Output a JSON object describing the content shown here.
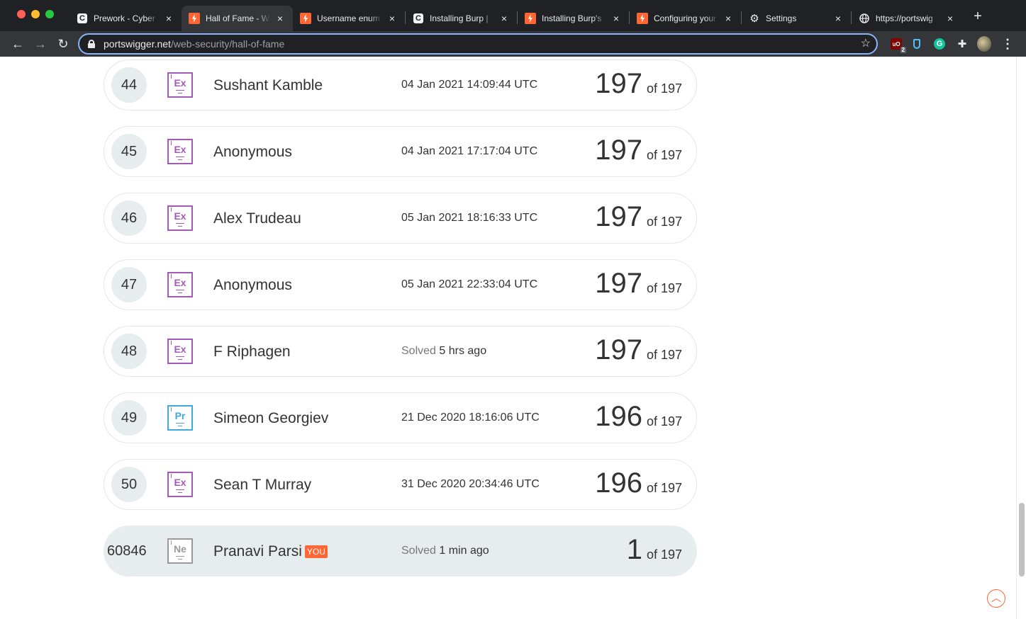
{
  "browser": {
    "tabs": [
      {
        "title": "Prework - Cyber",
        "favicon": "codepath-icon"
      },
      {
        "title": "Hall of Fame - W",
        "favicon": "portswigger-icon",
        "active": true
      },
      {
        "title": "Username enum",
        "favicon": "portswigger-icon"
      },
      {
        "title": "Installing Burp | ",
        "favicon": "codepath-icon"
      },
      {
        "title": "Installing Burp's",
        "favicon": "portswigger-icon"
      },
      {
        "title": "Configuring your",
        "favicon": "portswigger-icon"
      },
      {
        "title": "Settings",
        "favicon": "gear-icon"
      },
      {
        "title": "https://portswig",
        "favicon": "globe-icon"
      }
    ],
    "url_host": "portswigger.net",
    "url_path": "/web-security/hall-of-fame",
    "tab_close": "×",
    "new_tab": "+",
    "ext_badge": "2"
  },
  "leaderboard": {
    "rows": [
      {
        "rank": "44",
        "level": "Ex",
        "name": "Sushant Kamble",
        "solved_label": "",
        "date": "04 Jan 2021 14:09:44 UTC",
        "score": "197",
        "of": "of 197"
      },
      {
        "rank": "45",
        "level": "Ex",
        "name": "Anonymous",
        "solved_label": "",
        "date": "04 Jan 2021 17:17:04 UTC",
        "score": "197",
        "of": "of 197"
      },
      {
        "rank": "46",
        "level": "Ex",
        "name": "Alex Trudeau",
        "solved_label": "",
        "date": "05 Jan 2021 18:16:33 UTC",
        "score": "197",
        "of": "of 197"
      },
      {
        "rank": "47",
        "level": "Ex",
        "name": "Anonymous",
        "solved_label": "",
        "date": "05 Jan 2021 22:33:04 UTC",
        "score": "197",
        "of": "of 197"
      },
      {
        "rank": "48",
        "level": "Ex",
        "name": "F Riphagen",
        "solved_label": "Solved",
        "date": "5 hrs ago",
        "score": "197",
        "of": "of 197"
      },
      {
        "rank": "49",
        "level": "Pr",
        "name": "Simeon Georgiev",
        "solved_label": "",
        "date": "21 Dec 2020 18:16:06 UTC",
        "score": "196",
        "of": "of 197"
      },
      {
        "rank": "50",
        "level": "Ex",
        "name": "Sean T Murray",
        "solved_label": "",
        "date": "31 Dec 2020 20:34:46 UTC",
        "score": "196",
        "of": "of 197"
      }
    ],
    "you_row": {
      "rank": "60846",
      "level": "Ne",
      "name": "Pranavi Parsi",
      "badge": "YOU",
      "solved_label": "Solved",
      "date": "1 min ago",
      "score": "1",
      "of": "of 197"
    }
  },
  "colors": {
    "accent": "#ff6633",
    "expert": "#a35ab8",
    "practitioner": "#3fa9e0",
    "newcomer": "#9a9a9a"
  }
}
